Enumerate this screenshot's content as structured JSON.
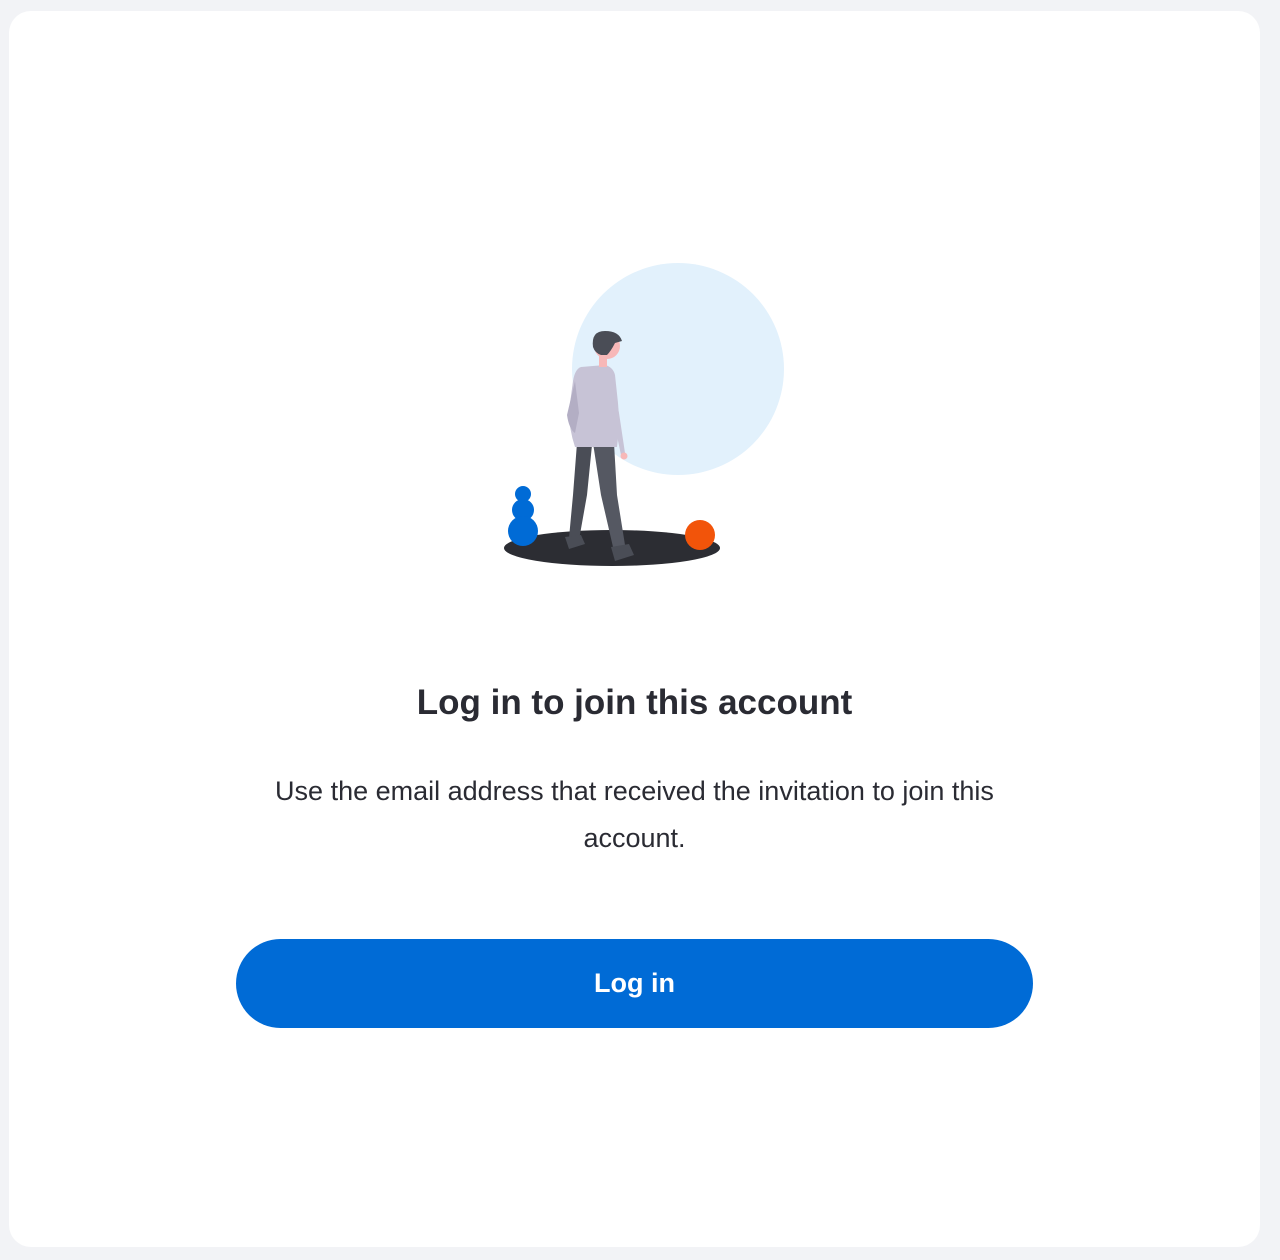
{
  "dialog": {
    "title": "Log in to join this account",
    "message": "Use the email address that received the invitation to join this account.",
    "login_label": "Log in"
  },
  "colors": {
    "page_background": "#f2f3f6",
    "card_background": "#ffffff",
    "primary": "#006bd6",
    "text": "#2a2b33",
    "illustration_circle": "#e2f1fc",
    "illustration_ball": "#f2540a",
    "illustration_shadow": "#2c2d33"
  },
  "illustration": {
    "icon": "person-walking-illustration"
  }
}
